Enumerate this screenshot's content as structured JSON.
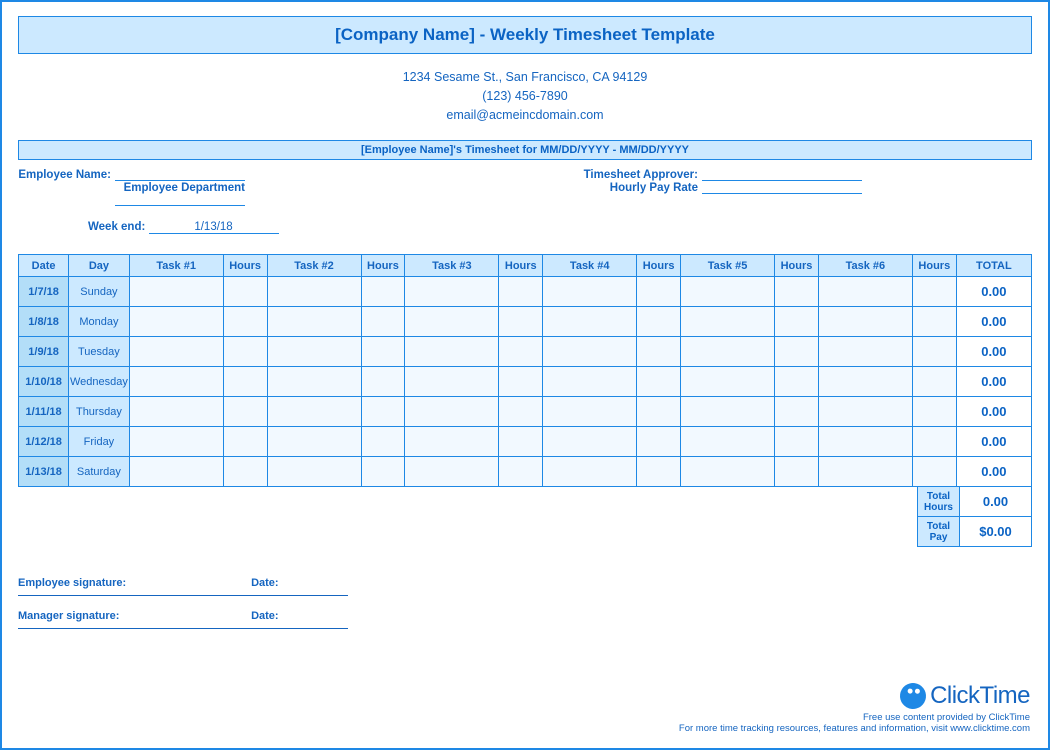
{
  "title": "[Company Name] - Weekly Timesheet Template",
  "company": {
    "address": "1234 Sesame St.,  San Francisco, CA 94129",
    "phone": "(123) 456-7890",
    "email": "email@acmeincdomain.com"
  },
  "subheader": "[Employee Name]'s Timesheet for MM/DD/YYYY - MM/DD/YYYY",
  "labels": {
    "employee_name": "Employee Name:",
    "employee_department": "Employee Department",
    "timesheet_approver": "Timesheet Approver:",
    "hourly_pay_rate": "Hourly Pay Rate",
    "week_end": "Week end:",
    "employee_signature": "Employee signature:",
    "manager_signature": "Manager signature:",
    "date": "Date:",
    "total_hours": "Total Hours",
    "total_pay": "Total Pay"
  },
  "week_end_value": "1/13/18",
  "columns": {
    "date": "Date",
    "day": "Day",
    "task1": "Task #1",
    "task2": "Task #2",
    "task3": "Task #3",
    "task4": "Task #4",
    "task5": "Task #5",
    "task6": "Task #6",
    "hours": "Hours",
    "total": "TOTAL"
  },
  "rows": [
    {
      "date": "1/7/18",
      "day": "Sunday",
      "total": "0.00"
    },
    {
      "date": "1/8/18",
      "day": "Monday",
      "total": "0.00"
    },
    {
      "date": "1/9/18",
      "day": "Tuesday",
      "total": "0.00"
    },
    {
      "date": "1/10/18",
      "day": "Wednesday",
      "total": "0.00"
    },
    {
      "date": "1/11/18",
      "day": "Thursday",
      "total": "0.00"
    },
    {
      "date": "1/12/18",
      "day": "Friday",
      "total": "0.00"
    },
    {
      "date": "1/13/18",
      "day": "Saturday",
      "total": "0.00"
    }
  ],
  "summary": {
    "total_hours": "0.00",
    "total_pay": "$0.00"
  },
  "footer": {
    "brand": "ClickTime",
    "line1": "Free use content provided by ClickTime",
    "line2": "For more time tracking resources, features and information, visit www.clicktime.com"
  }
}
